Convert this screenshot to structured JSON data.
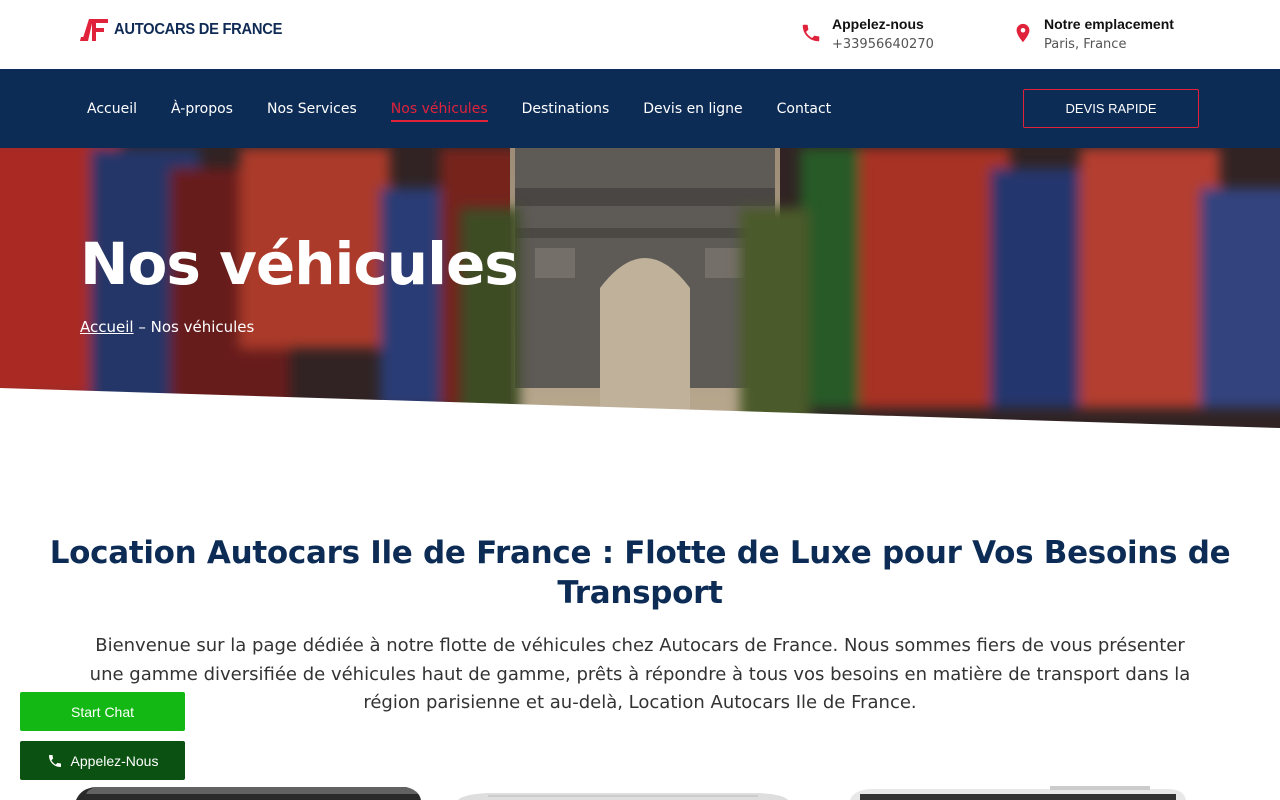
{
  "brand": {
    "logo_text": "AUTOCARS DE FRANCE",
    "accent": "#e0233b",
    "navy": "#0c2c56"
  },
  "contacts": [
    {
      "icon": "phone-icon",
      "title": "Appelez-nous",
      "sub": "+33956640270"
    },
    {
      "icon": "location-pin-icon",
      "title": "Notre emplacement",
      "sub": "Paris, France"
    }
  ],
  "nav": {
    "items": [
      "Accueil",
      "À-propos",
      "Nos Services",
      "Nos véhicules",
      "Destinations",
      "Devis en ligne",
      "Contact"
    ],
    "active": "Nos véhicules",
    "quote_button": "DEVIS RAPIDE"
  },
  "hero": {
    "title": "Nos véhicules",
    "breadcrumb_home": "Accueil",
    "breadcrumb_sep": " – ",
    "breadcrumb_current": "Nos véhicules"
  },
  "content": {
    "heading": "Location Autocars Ile de France : Flotte de Luxe pour Vos Besoins de Transport",
    "intro": "Bienvenue sur la page dédiée à notre flotte de véhicules chez Autocars de France. Nous sommes fiers de vous présenter une gamme diversifiée de véhicules haut de gamme, prêts à répondre à tous vos besoins en matière de transport dans la région parisienne et au-delà, Location Autocars Ile de France."
  },
  "floating": {
    "chat_label": "Start Chat",
    "call_label": "Appelez-Nous"
  }
}
